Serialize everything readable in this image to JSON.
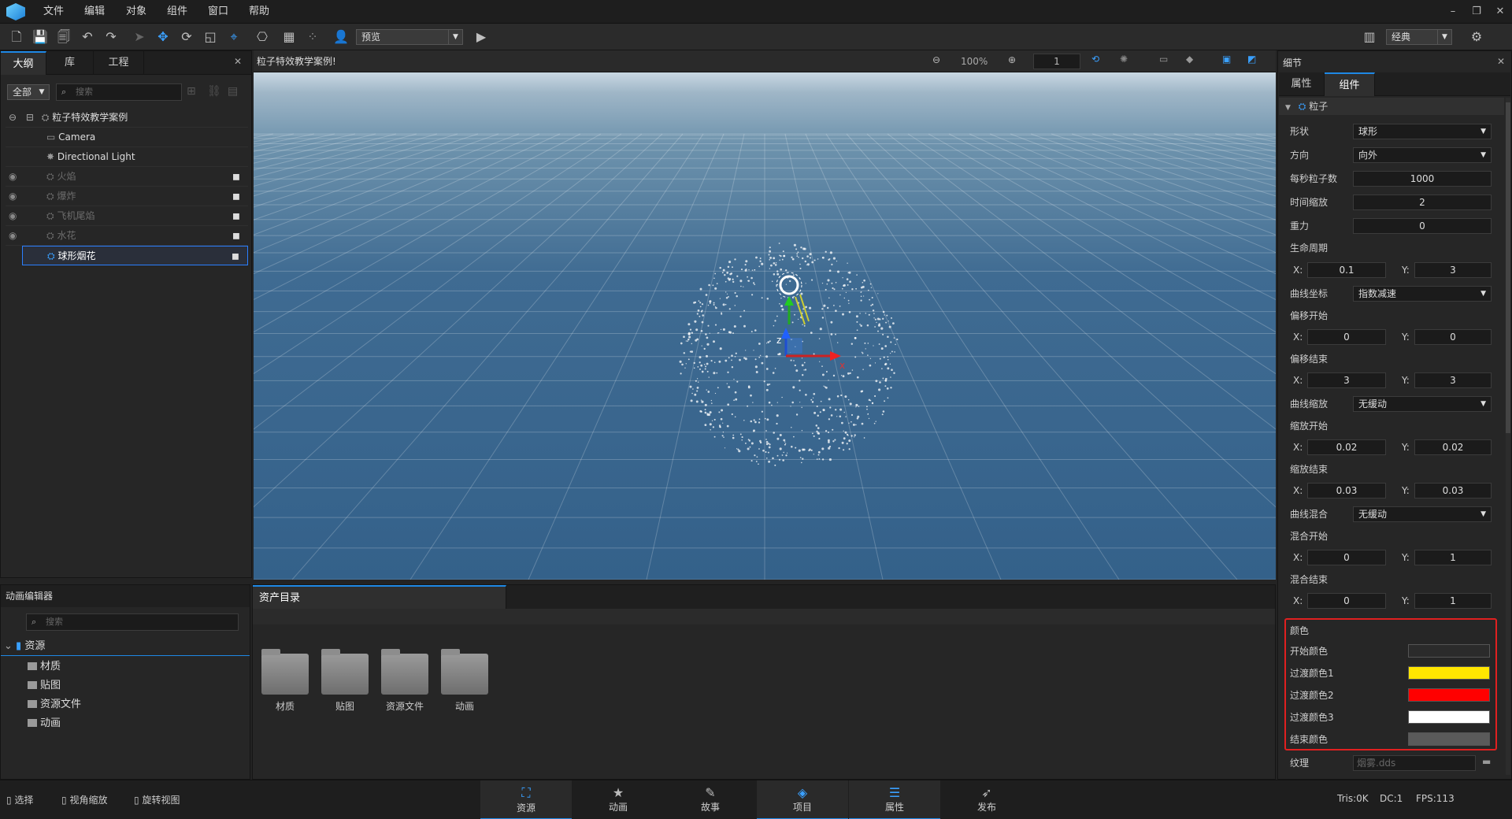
{
  "menu": {
    "items": [
      "文件",
      "编辑",
      "对象",
      "组件",
      "窗口",
      "帮助"
    ]
  },
  "toolbar": {
    "preview_label": "预览",
    "layout_label": "经典"
  },
  "outline": {
    "tabs": [
      "大纲",
      "库",
      "工程"
    ],
    "filter": "全部",
    "search_placeholder": "搜索",
    "root": "粒子特效教学案例",
    "items": [
      {
        "label": "Camera",
        "icon": "camera-icon"
      },
      {
        "label": "Directional Light",
        "icon": "light-icon"
      },
      {
        "label": "火焰",
        "icon": "particle-icon"
      },
      {
        "label": "爆炸",
        "icon": "particle-icon"
      },
      {
        "label": "飞机尾焰",
        "icon": "particle-icon"
      },
      {
        "label": "水花",
        "icon": "particle-icon"
      },
      {
        "label": "球形烟花",
        "icon": "particle-icon"
      }
    ]
  },
  "viewport": {
    "title": "粒子特效教学案例!",
    "zoom": "100%",
    "frame": "1"
  },
  "details": {
    "title": "细节",
    "tabs": [
      "属性",
      "组件"
    ],
    "section": "粒子",
    "shape_label": "形状",
    "shape_value": "球形",
    "direction_label": "方向",
    "direction_value": "向外",
    "rate_label": "每秒粒子数",
    "rate_value": "1000",
    "timescale_label": "时间缩放",
    "timescale_value": "2",
    "gravity_label": "重力",
    "gravity_value": "0",
    "life_label": "生命周期",
    "life_x": "0.1",
    "life_y": "3",
    "curve_coord_label": "曲线坐标",
    "curve_coord_value": "指数减速",
    "offset_start_label": "偏移开始",
    "offset_start_x": "0",
    "offset_start_y": "0",
    "offset_end_label": "偏移结束",
    "offset_end_x": "3",
    "offset_end_y": "3",
    "curve_scale_label": "曲线缩放",
    "curve_scale_value": "无缓动",
    "scale_start_label": "缩放开始",
    "scale_start_x": "0.02",
    "scale_start_y": "0.02",
    "scale_end_label": "缩放结束",
    "scale_end_x": "0.03",
    "scale_end_y": "0.03",
    "curve_blend_label": "曲线混合",
    "curve_blend_value": "无缓动",
    "blend_start_label": "混合开始",
    "blend_start_x": "0",
    "blend_start_y": "1",
    "blend_end_label": "混合结束",
    "blend_end_x": "0",
    "blend_end_y": "1",
    "x_label": "X:",
    "y_label": "Y:",
    "color_section": "颜色",
    "colors": [
      {
        "label": "开始颜色",
        "value": "#2b2b2b"
      },
      {
        "label": "过渡颜色1",
        "value": "#ffe600"
      },
      {
        "label": "过渡颜色2",
        "value": "#ff0000"
      },
      {
        "label": "过渡颜色3",
        "value": "#ffffff"
      },
      {
        "label": "结束颜色",
        "value": "#5a5a5a"
      }
    ],
    "texture_label": "纹理",
    "texture_value": "烟雾.dds"
  },
  "anim_editor": {
    "title": "动画编辑器",
    "search_placeholder": "搜索"
  },
  "assets": {
    "tab": "资产目录",
    "tree_root": "资源",
    "tree_items": [
      "材质",
      "贴图",
      "资源文件",
      "动画"
    ],
    "folders": [
      "材质",
      "贴图",
      "资源文件",
      "动画"
    ]
  },
  "status": {
    "tools": [
      "选择",
      "视角缩放",
      "旋转视图"
    ],
    "tris": "Tris:0K",
    "dc": "DC:1",
    "fps": "FPS:113"
  },
  "bottom_tabs": [
    {
      "label": "资源",
      "icon": "resource-icon"
    },
    {
      "label": "动画",
      "icon": "animation-icon"
    },
    {
      "label": "故事",
      "icon": "story-icon"
    },
    {
      "label": "项目",
      "icon": "project-icon"
    },
    {
      "label": "属性",
      "icon": "properties-icon"
    },
    {
      "label": "发布",
      "icon": "publish-icon"
    }
  ],
  "accent": "#1e88e5",
  "highlight_border": "#e02020"
}
